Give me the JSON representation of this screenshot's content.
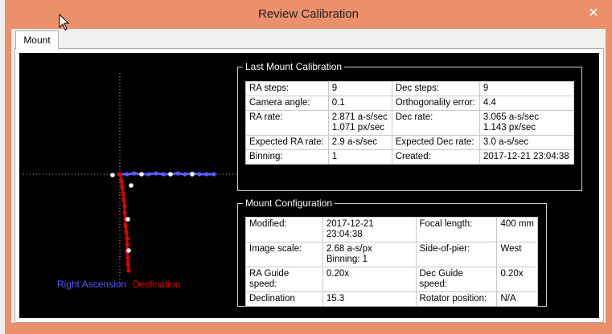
{
  "window": {
    "title": "Review Calibration",
    "close_glyph": "✕"
  },
  "tabs": [
    {
      "label": "Mount"
    }
  ],
  "legend": {
    "ra": "Right Ascension",
    "dec": "Declination"
  },
  "colors": {
    "ra": "#5a5aff",
    "dec": "#e00000",
    "titlebar": "#eb906b"
  },
  "calibration": {
    "title": "Last Mount Calibration",
    "rows": [
      [
        "RA steps:",
        "9",
        "Dec steps:",
        "9"
      ],
      [
        "Camera angle:",
        "0.1",
        "Orthogonality error:",
        "4.4"
      ],
      [
        "RA rate:",
        "2.871 a-s/sec\n1.071 px/sec",
        "Dec rate:",
        "3.065 a-s/sec\n1.143 px/sec"
      ],
      [
        "Expected RA rate:",
        "2.9 a-s/sec",
        "Expected Dec rate:",
        "3.0 a-s/sec"
      ],
      [
        "Binning:",
        "1",
        "Created:",
        "2017-12-21 23:04:38"
      ]
    ]
  },
  "configuration": {
    "title": "Mount Configuration",
    "rows": [
      [
        "Modified:",
        "2017-12-21 23:04:38",
        "Focal length:",
        "400 mm"
      ],
      [
        "Image scale:",
        "2.68 a-s/px\nBinning: 1",
        "Side-of-pier:",
        "West"
      ],
      [
        "RA Guide speed:",
        "0.20x",
        "Dec Guide speed:",
        "0.20x"
      ],
      [
        "Declination",
        "15.3",
        "Rotator position:",
        "N/A"
      ]
    ]
  },
  "plot": {
    "ra_points": [
      [
        0,
        0
      ],
      [
        9,
        0
      ],
      [
        18,
        -1
      ],
      [
        27,
        0
      ],
      [
        36,
        0
      ],
      [
        45,
        -1
      ],
      [
        54,
        0
      ],
      [
        63,
        0
      ],
      [
        72,
        -1
      ],
      [
        81,
        0
      ],
      [
        90,
        -1
      ],
      [
        99,
        0
      ],
      [
        108,
        0
      ],
      [
        117,
        0
      ]
    ],
    "ra_white": [
      [
        -9,
        1
      ],
      [
        27,
        0
      ],
      [
        63,
        0
      ],
      [
        90,
        0
      ]
    ],
    "dec_points": [
      [
        0,
        0
      ],
      [
        2,
        8
      ],
      [
        3,
        16
      ],
      [
        4,
        24
      ],
      [
        5,
        32
      ],
      [
        6,
        40
      ],
      [
        6,
        48
      ],
      [
        7,
        56
      ],
      [
        7,
        64
      ],
      [
        8,
        72
      ],
      [
        9,
        80
      ],
      [
        9,
        88
      ],
      [
        9,
        96
      ],
      [
        10,
        104
      ],
      [
        10,
        112
      ],
      [
        11,
        120
      ]
    ],
    "dec_white": [
      [
        14,
        14
      ],
      [
        10,
        56
      ],
      [
        11,
        95
      ]
    ]
  }
}
